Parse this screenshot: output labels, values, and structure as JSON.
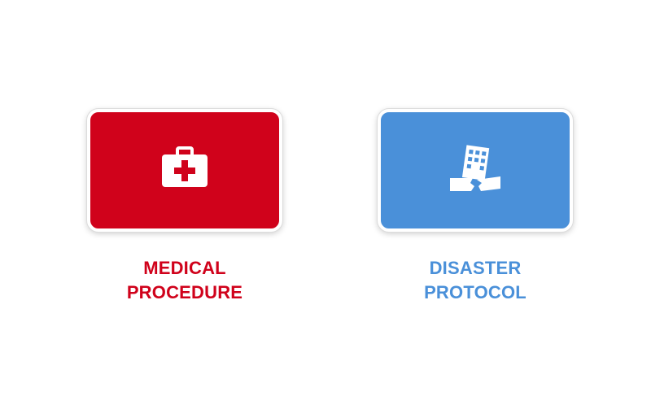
{
  "options": [
    {
      "id": "medical",
      "icon": "first-aid-kit-icon",
      "color": "#d0021b",
      "label_line1": "MEDICAL",
      "label_line2": "PROCEDURE"
    },
    {
      "id": "disaster",
      "icon": "collapsed-building-icon",
      "color": "#4a90d9",
      "label_line1": "DISASTER",
      "label_line2": "PROTOCOL"
    }
  ],
  "background": "#ffffff"
}
